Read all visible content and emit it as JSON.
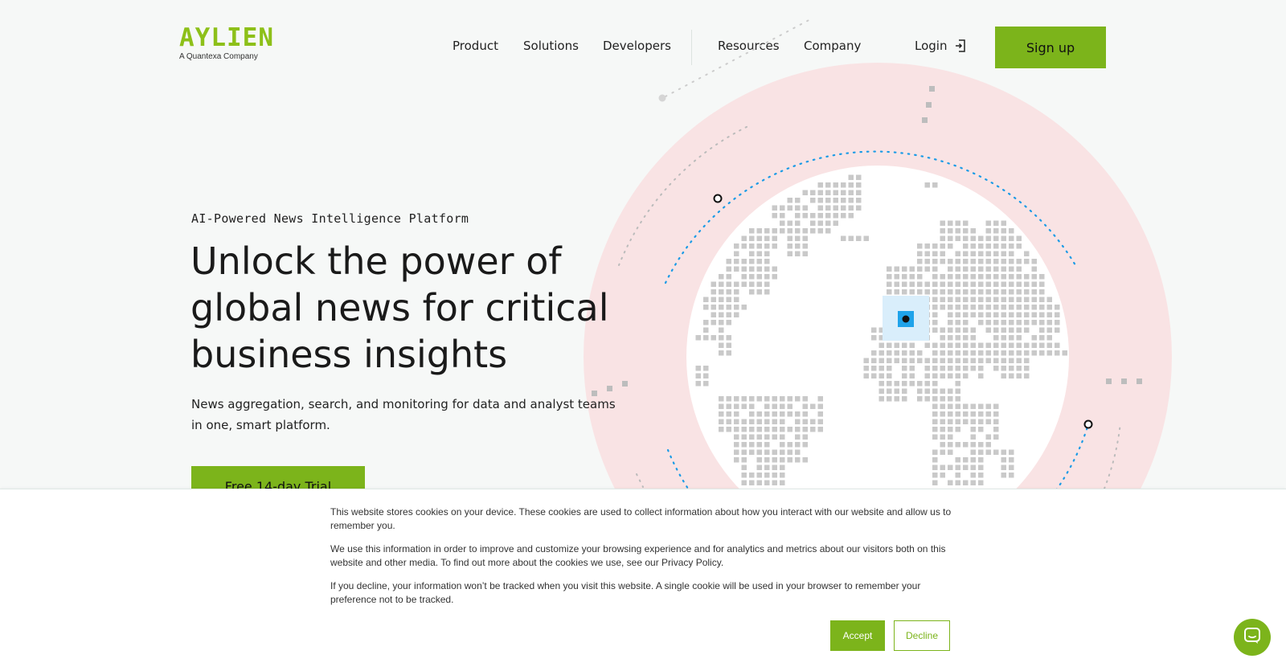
{
  "logo": {
    "wordmark": "AYLIEN",
    "tagline": "A Quantexa Company"
  },
  "nav": {
    "items": [
      "Product",
      "Solutions",
      "Developers",
      "Resources",
      "Company"
    ],
    "login": "Login",
    "signup": "Sign up"
  },
  "hero": {
    "eyebrow": "AI-Powered News Intelligence Platform",
    "headline": "Unlock the power of global news for critical business insights",
    "subtext": "News aggregation, search, and monitoring for data and analyst teams in one, smart platform.",
    "cta": "Free 14-day Trial"
  },
  "cookie": {
    "p1": "This website stores cookies on your device. These cookies are used to collect information about how you interact with our website and allow us to remember you.",
    "p2": "We use this information in order to improve and customize your browsing experience and for analytics and metrics about our visitors both on this website and other media. To find out more about the cookies we use, see our Privacy Policy.",
    "p3": "If you decline, your information won’t be tracked when you visit this website. A single cookie will be used in your browser to remember your preference not to be tracked.",
    "accept": "Accept",
    "decline": "Decline"
  },
  "colors": {
    "brand_green": "#7cb41b",
    "logo_green": "#8dc019",
    "ring_pink": "#f9e3e4",
    "dot_blue": "#1a9be6",
    "marker_blue": "#1fa3ea"
  },
  "icons": {
    "login": "login-icon",
    "chat": "chat-bubble-icon"
  }
}
